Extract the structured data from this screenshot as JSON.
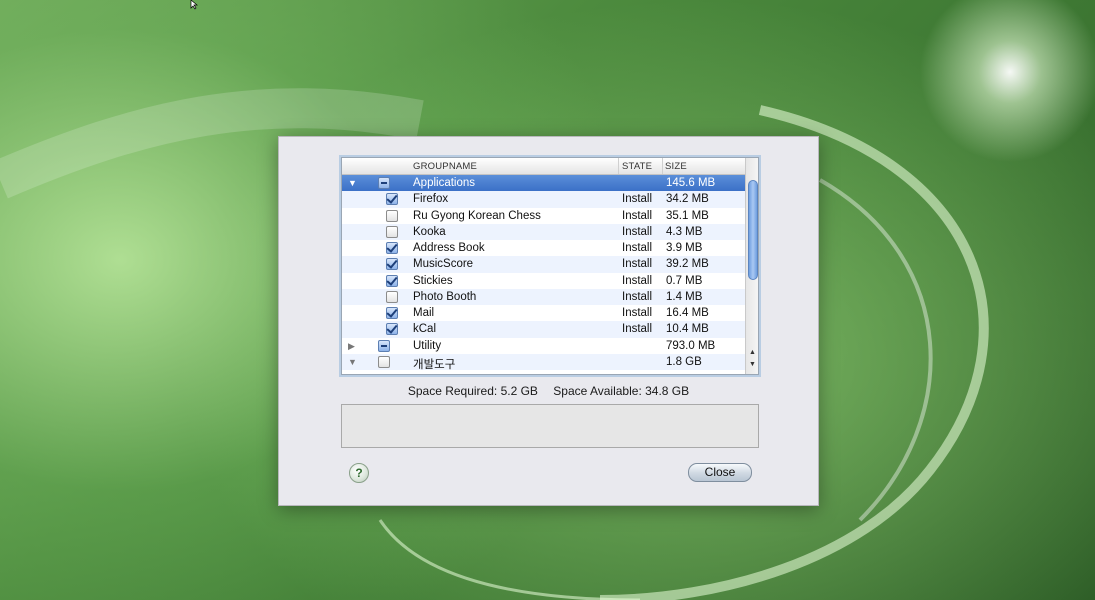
{
  "installer": {
    "columns": {
      "groupname": "GROUPNAME",
      "state": "STATE",
      "size": "SIZE"
    },
    "rows": [
      {
        "name": "Applications",
        "state": "",
        "size": "145.6 MB",
        "kind": "group",
        "expanded": true,
        "check": "mixed",
        "selected": true
      },
      {
        "name": "Firefox",
        "state": "Install",
        "size": "34.2 MB",
        "kind": "item",
        "check": "checked"
      },
      {
        "name": "Ru Gyong Korean Chess",
        "state": "Install",
        "size": "35.1 MB",
        "kind": "item",
        "check": "unchecked"
      },
      {
        "name": "Kooka",
        "state": "Install",
        "size": "4.3 MB",
        "kind": "item",
        "check": "unchecked"
      },
      {
        "name": "Address Book",
        "state": "Install",
        "size": "3.9 MB",
        "kind": "item",
        "check": "checked"
      },
      {
        "name": "MusicScore",
        "state": "Install",
        "size": "39.2 MB",
        "kind": "item",
        "check": "checked"
      },
      {
        "name": "Stickies",
        "state": "Install",
        "size": "0.7 MB",
        "kind": "item",
        "check": "checked"
      },
      {
        "name": "Photo Booth",
        "state": "Install",
        "size": "1.4 MB",
        "kind": "item",
        "check": "unchecked"
      },
      {
        "name": "Mail",
        "state": "Install",
        "size": "16.4 MB",
        "kind": "item",
        "check": "checked"
      },
      {
        "name": "kCal",
        "state": "Install",
        "size": "10.4 MB",
        "kind": "item",
        "check": "checked"
      },
      {
        "name": "Utility",
        "state": "",
        "size": "793.0 MB",
        "kind": "group",
        "expanded": false,
        "check": "mixed"
      },
      {
        "name": "개발도구",
        "state": "",
        "size": "1.8 GB",
        "kind": "group",
        "expanded": true,
        "check": "unchecked"
      }
    ],
    "space_required": "Space Required: 5.2 GB",
    "space_available": "Space Available: 34.8 GB",
    "help_label": "?",
    "close_label": "Close",
    "icons": {
      "expanded": "disclosure-expanded-icon",
      "collapsed": "disclosure-collapsed-icon",
      "help": "help-icon"
    }
  }
}
